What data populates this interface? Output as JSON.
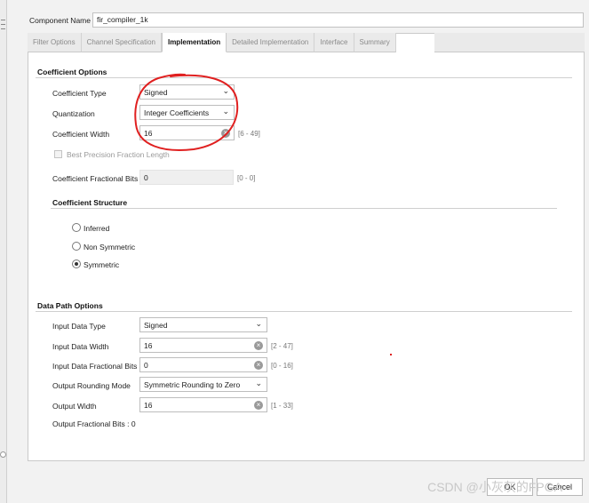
{
  "component": {
    "label": "Component Name",
    "value": "fir_compiler_1k"
  },
  "tabs": [
    {
      "label": "Filter Options",
      "active": false
    },
    {
      "label": "Channel Specification",
      "active": false
    },
    {
      "label": "Implementation",
      "active": true
    },
    {
      "label": "Detailed Implementation",
      "active": false
    },
    {
      "label": "Interface",
      "active": false
    },
    {
      "label": "Summary",
      "active": false
    }
  ],
  "coefficient_options": {
    "title": "Coefficient Options",
    "type": {
      "label": "Coefficient Type",
      "value": "Signed"
    },
    "quantization": {
      "label": "Quantization",
      "value": "Integer Coefficients"
    },
    "width": {
      "label": "Coefficient Width",
      "value": "16",
      "range": "[6 - 49]"
    },
    "best_precision": {
      "label": "Best Precision Fraction Length"
    },
    "fractional_bits": {
      "label": "Coefficient Fractional Bits",
      "value": "0",
      "range": "[0 - 0]"
    }
  },
  "coefficient_structure": {
    "title": "Coefficient Structure",
    "options": [
      "Inferred",
      "Non Symmetric",
      "Symmetric"
    ],
    "selected": "Symmetric"
  },
  "data_path": {
    "title": "Data Path Options",
    "input_type": {
      "label": "Input Data Type",
      "value": "Signed"
    },
    "input_width": {
      "label": "Input Data Width",
      "value": "16",
      "range": "[2 - 47]"
    },
    "input_frac": {
      "label": "Input Data Fractional Bits",
      "value": "0",
      "range": "[0 - 16]"
    },
    "rounding": {
      "label": "Output Rounding Mode",
      "value": "Symmetric Rounding to Zero"
    },
    "output_width": {
      "label": "Output Width",
      "value": "16",
      "range": "[1 - 33]"
    },
    "output_frac": {
      "label": "Output Fractional Bits : 0"
    }
  },
  "footer": {
    "watermark": "CSDN @小灰灰的FPGA",
    "ok": "OK",
    "cancel": "Cancel"
  }
}
